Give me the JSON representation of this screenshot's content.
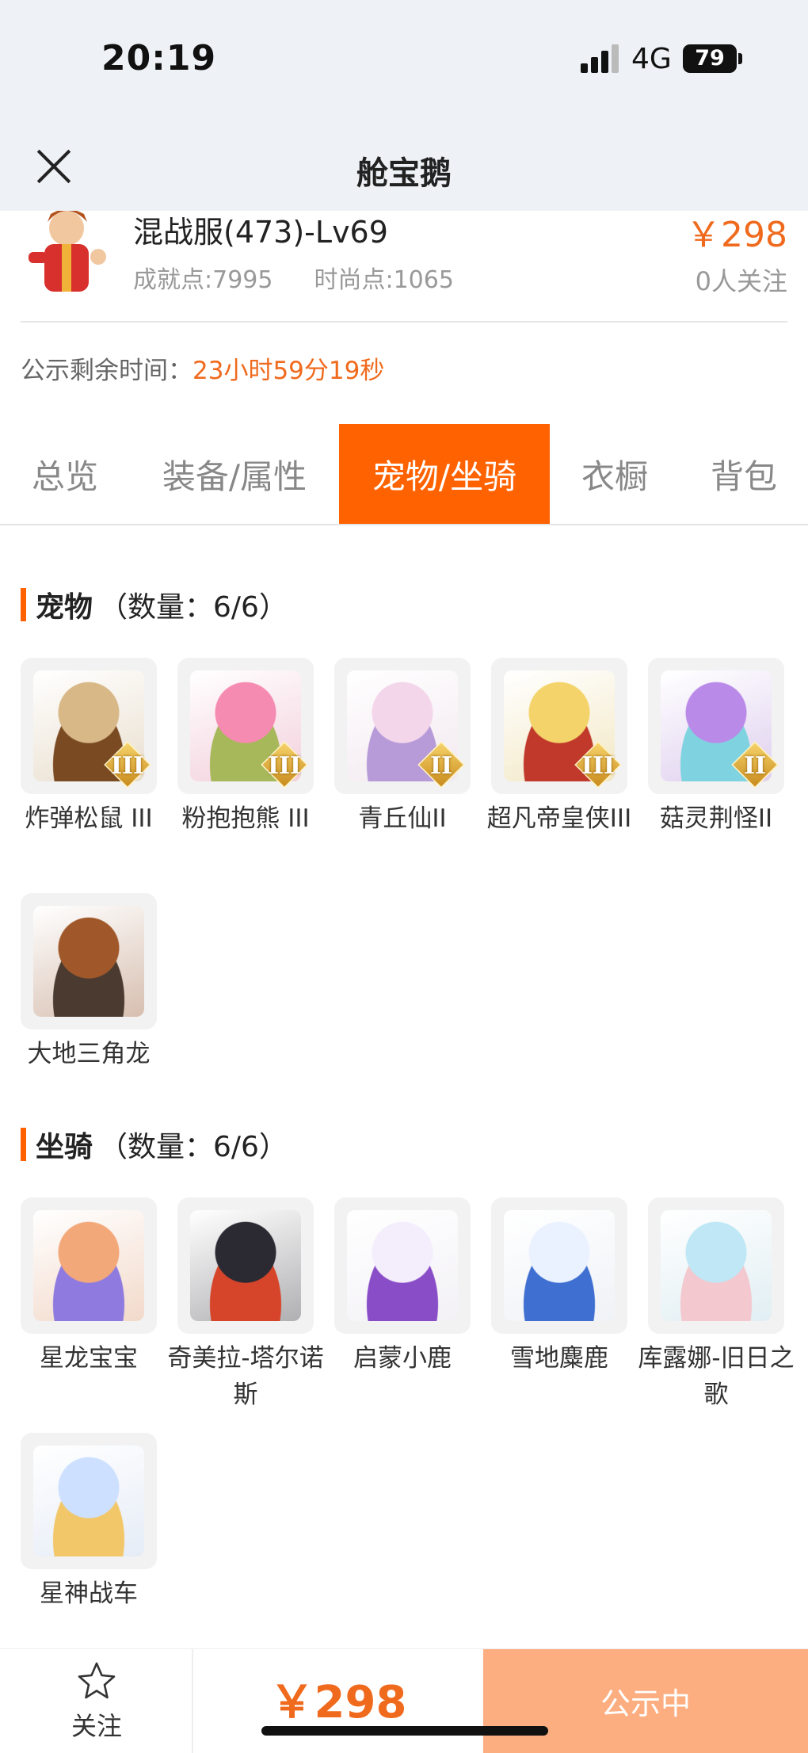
{
  "status_bar": {
    "time": "20:19",
    "network": "4G",
    "battery": "79"
  },
  "nav": {
    "title": "舱宝鹅"
  },
  "account": {
    "server_level": "混战服(473)-Lv69",
    "achievement": "成就点:7995",
    "fashion": "时尚点:1065",
    "price": "￥298",
    "followers": "0人关注"
  },
  "countdown": {
    "label": "公示剩余时间：",
    "value": "23小时59分19秒"
  },
  "tabs": [
    {
      "label": "总览"
    },
    {
      "label": "装备/属性"
    },
    {
      "label": "宠物/坐骑",
      "active": true
    },
    {
      "label": "衣橱"
    },
    {
      "label": "背包"
    }
  ],
  "pets": {
    "title": "宠物",
    "count": "（数量：6/6）",
    "items": [
      {
        "name": "炸弹松鼠 III",
        "rank": "III",
        "icon": "squirrel-pet-icon",
        "colors": [
          "#d8b887",
          "#7a4a22"
        ]
      },
      {
        "name": "粉抱抱熊 III",
        "rank": "III",
        "icon": "pink-bear-pet-icon",
        "colors": [
          "#f58bb0",
          "#a7b85a"
        ]
      },
      {
        "name": "青丘仙II",
        "rank": "II",
        "icon": "fox-fairy-pet-icon",
        "colors": [
          "#f3d6ea",
          "#b79ad8"
        ]
      },
      {
        "name": "超凡帝皇侠III",
        "rank": "III",
        "icon": "golden-hero-pet-icon",
        "colors": [
          "#f4d36a",
          "#c0392b"
        ]
      },
      {
        "name": "菇灵荆怪II",
        "rank": "II",
        "icon": "mushroom-elf-pet-icon",
        "colors": [
          "#b98ae8",
          "#7fd3e0"
        ]
      },
      {
        "name": "大地三角龙",
        "rank": "",
        "icon": "triceratops-pet-icon",
        "colors": [
          "#a0582a",
          "#4a3a30"
        ]
      }
    ]
  },
  "mounts": {
    "title": "坐骑",
    "count": "（数量：6/6）",
    "items": [
      {
        "name": "星龙宝宝",
        "icon": "baby-dragon-mount-icon",
        "colors": [
          "#f3a87a",
          "#8f7be0"
        ]
      },
      {
        "name": "奇美拉-塔尔诺斯",
        "icon": "chimera-mount-icon",
        "colors": [
          "#2b2a33",
          "#d6452a"
        ]
      },
      {
        "name": "启蒙小鹿",
        "icon": "white-deer-mount-icon",
        "colors": [
          "#f4eefc",
          "#8a4dc8"
        ]
      },
      {
        "name": "雪地麋鹿",
        "icon": "snow-elk-mount-icon",
        "colors": [
          "#eaf2ff",
          "#3e6fd1"
        ]
      },
      {
        "name": "库露娜-旧日之歌",
        "icon": "kuluna-mount-icon",
        "colors": [
          "#bfe7f5",
          "#f3c8cf"
        ]
      },
      {
        "name": "星神战车",
        "icon": "star-chariot-mount-icon",
        "colors": [
          "#cde0ff",
          "#f2c76a"
        ]
      }
    ]
  },
  "bottom": {
    "follow_label": "关注",
    "price": "￥298",
    "status": "公示中"
  }
}
